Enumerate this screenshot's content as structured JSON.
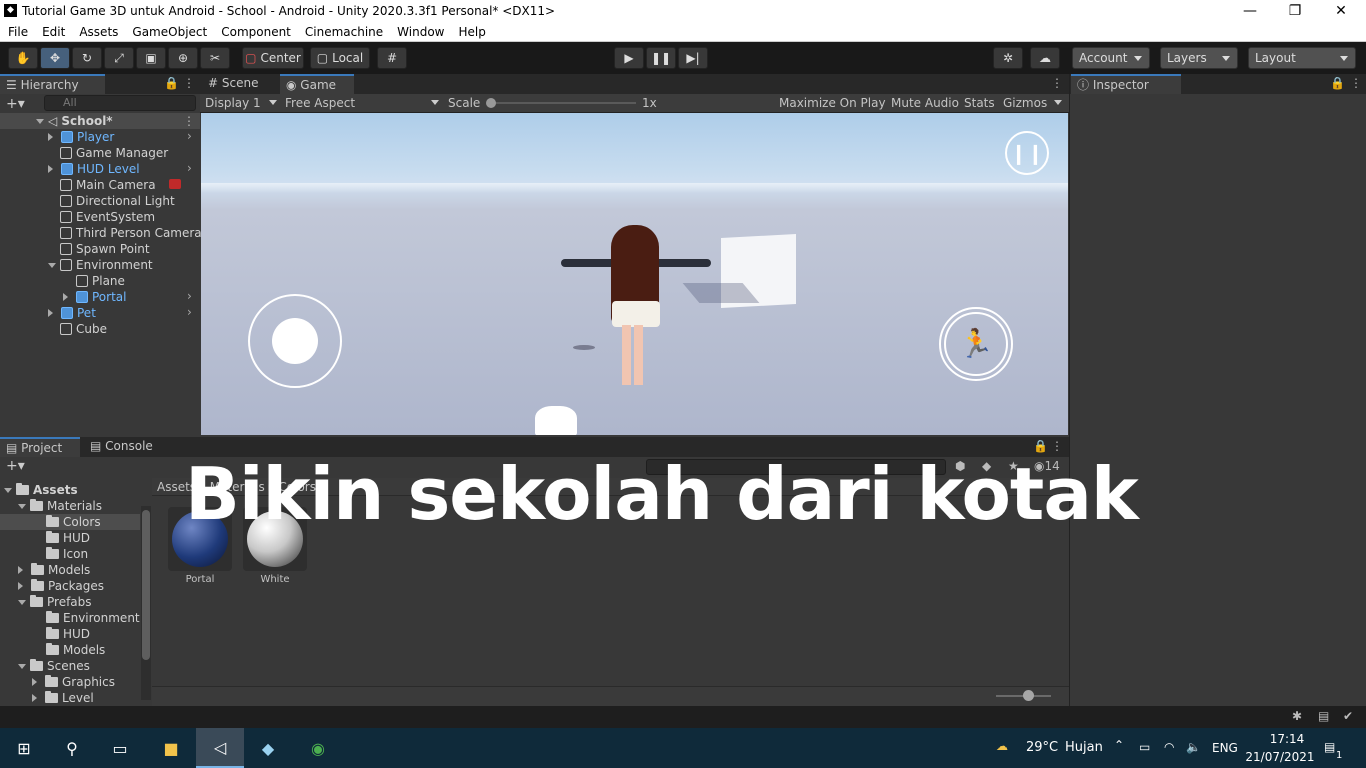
{
  "window": {
    "title": "Tutorial Game 3D untuk Android - School - Android - Unity 2020.3.3f1 Personal* <DX11>",
    "minimize": "—",
    "maximize": "❐",
    "close": "✕"
  },
  "menu": [
    "File",
    "Edit",
    "Assets",
    "GameObject",
    "Component",
    "Cinemachine",
    "Window",
    "Help"
  ],
  "toolbar": {
    "pivot": "Center",
    "space": "Local",
    "account": "Account",
    "layers": "Layers",
    "layout": "Layout"
  },
  "hierarchy": {
    "tab": "Hierarchy",
    "search_placeholder": "All",
    "scene": "School*",
    "items": [
      {
        "label": "Player",
        "blue": true
      },
      {
        "label": "Game Manager",
        "blue": false
      },
      {
        "label": "HUD Level",
        "blue": true
      },
      {
        "label": "Main Camera",
        "blue": false
      },
      {
        "label": "Directional Light",
        "blue": false
      },
      {
        "label": "EventSystem",
        "blue": false
      },
      {
        "label": "Third Person Camera",
        "blue": false
      },
      {
        "label": "Spawn Point",
        "blue": false
      },
      {
        "label": "Environment",
        "blue": false
      },
      {
        "label": "Plane",
        "blue": false
      },
      {
        "label": "Portal",
        "blue": true
      },
      {
        "label": "Pet",
        "blue": true
      },
      {
        "label": "Cube",
        "blue": false
      }
    ]
  },
  "game_view": {
    "tabs": [
      "Scene",
      "Game"
    ],
    "display": "Display 1",
    "aspect": "Free Aspect",
    "scale_label": "Scale",
    "scale_value": "1x",
    "options": [
      "Maximize On Play",
      "Mute Audio",
      "Stats",
      "Gizmos"
    ]
  },
  "inspector": {
    "tab": "Inspector"
  },
  "project": {
    "tabs": [
      "Project",
      "Console"
    ],
    "visible_count": "14",
    "breadcrumb": [
      "Assets",
      "Materials",
      "Colors"
    ],
    "tree": [
      {
        "label": "Assets",
        "bold": true
      },
      {
        "label": "Materials"
      },
      {
        "label": "Colors"
      },
      {
        "label": "HUD"
      },
      {
        "label": "Icon"
      },
      {
        "label": "Models"
      },
      {
        "label": "Packages"
      },
      {
        "label": "Prefabs"
      },
      {
        "label": "Environment"
      },
      {
        "label": "HUD"
      },
      {
        "label": "Models"
      },
      {
        "label": "Scenes"
      },
      {
        "label": "Graphics"
      },
      {
        "label": "Level"
      }
    ],
    "assets": [
      {
        "label": "Portal",
        "color": "#1f3a7a"
      },
      {
        "label": "White",
        "color": "#c8c8c8"
      }
    ]
  },
  "overlay_caption": "Bikin sekolah dari kotak",
  "taskbar": {
    "weather_temp": "29°C",
    "weather_desc": "Hujan",
    "lang": "ENG",
    "time": "17:14",
    "date": "21/07/2021",
    "notif_count": "1"
  }
}
